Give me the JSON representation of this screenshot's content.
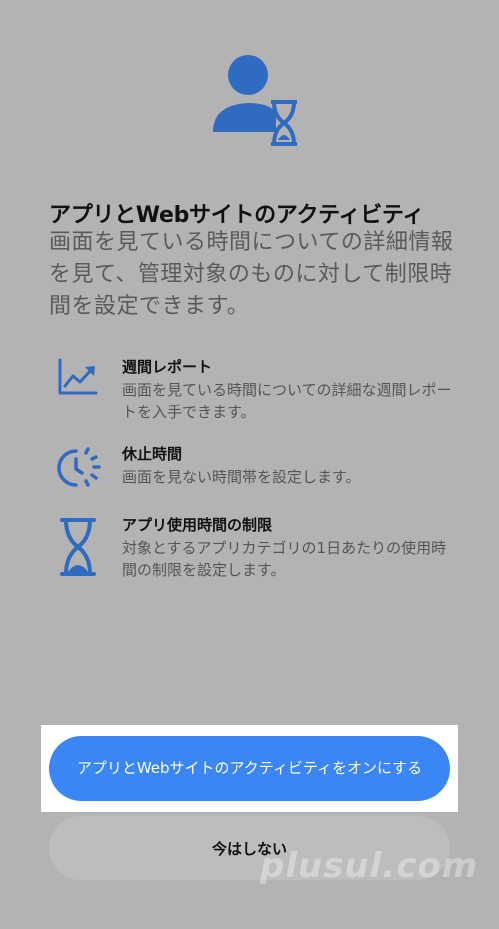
{
  "header": {
    "title": "アプリとWebサイトのアクティビティ",
    "description": "画面を見ている時間についての詳細情報を見て、管理対象のものに対して制限時間を設定できます。"
  },
  "features": [
    {
      "icon": "chart-icon",
      "title": "週間レポート",
      "text": "画面を見ている時間についての詳細な週間レポートを入手できます。"
    },
    {
      "icon": "downtime-icon",
      "title": "休止時間",
      "text": "画面を見ない時間帯を設定します。"
    },
    {
      "icon": "hourglass-icon",
      "title": "アプリ使用時間の制限",
      "text": "対象とするアプリカテゴリの1日あたりの使用時間の制限を設定します。"
    }
  ],
  "buttons": {
    "primary_label": "アプリとWebサイトのアクティビティをオンにする",
    "secondary_label": "今はしない"
  },
  "watermark": "plusul.com",
  "colors": {
    "accent": "#3a86f5",
    "icon_blue": "#2f6bc0",
    "background": "#b3b3b3"
  }
}
